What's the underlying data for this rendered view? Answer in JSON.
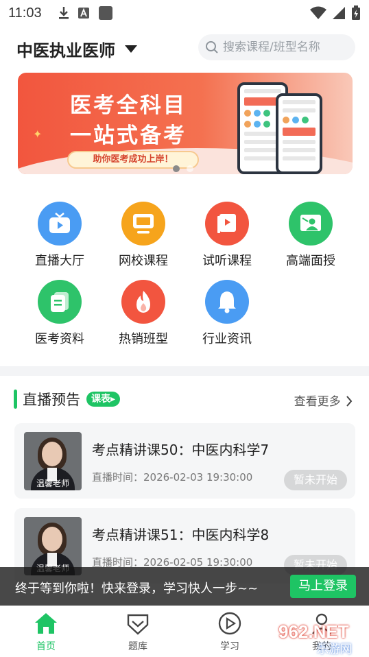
{
  "status_bar": {
    "time": "11:03"
  },
  "header": {
    "exam_title": "中医执业医师",
    "search_placeholder": "搜索课程/班型名称"
  },
  "banner": {
    "title_line1": "医考全科目",
    "title_line2": "一站式备考",
    "slogan": "助你医考成功上岸！",
    "indicator_count": 2,
    "active_index": 0
  },
  "grid": [
    {
      "label": "直播大厅",
      "icon": "tv-icon",
      "color": "#4a9cf3"
    },
    {
      "label": "网校课程",
      "icon": "monitor-icon",
      "color": "#f6a41c"
    },
    {
      "label": "试听课程",
      "icon": "video-book-icon",
      "color": "#f2553f"
    },
    {
      "label": "高端面授",
      "icon": "face-teaching-icon",
      "color": "#2ec36a"
    },
    {
      "label": "医考资料",
      "icon": "documents-icon",
      "color": "#2ec36a"
    },
    {
      "label": "热销班型",
      "icon": "fire-icon",
      "color": "#f2553f"
    },
    {
      "label": "行业资讯",
      "icon": "bell-icon",
      "color": "#4a9cf3"
    }
  ],
  "live": {
    "section_title": "直播预告",
    "badge": "课表▸",
    "more_label": "查看更多",
    "cards": [
      {
        "title": "考点精讲课50：中医内科学7",
        "time": "直播时间：2026-02-03 19:30:00",
        "status": "暂未开始",
        "teacher": "温馨老师"
      },
      {
        "title": "考点精讲课51：中医内科学8",
        "time": "直播时间：2026-02-05 19:30:00",
        "status": "暂未开始",
        "teacher": "温馨老师"
      }
    ]
  },
  "toast": {
    "message": "终于等到你啦！快来登录，学习快人一步~~",
    "button": "马上登录"
  },
  "nav": [
    {
      "label": "首页",
      "icon": "home-icon",
      "active": true
    },
    {
      "label": "题库",
      "icon": "question-bank-icon",
      "active": false
    },
    {
      "label": "学习",
      "icon": "play-icon",
      "active": false
    },
    {
      "label": "我的",
      "icon": "profile-icon",
      "active": false
    }
  ],
  "watermark": {
    "number": "962.NET",
    "text": "乐游网"
  },
  "colors": {
    "accent": "#1ec464",
    "banner": "#f2563e"
  }
}
